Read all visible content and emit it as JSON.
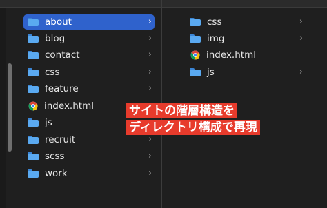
{
  "left_column": {
    "items": [
      {
        "label": "about",
        "icon": "folder-icon"
      },
      {
        "label": "blog",
        "icon": "folder-icon"
      },
      {
        "label": "contact",
        "icon": "folder-icon"
      },
      {
        "label": "css",
        "icon": "folder-icon"
      },
      {
        "label": "feature",
        "icon": "folder-icon"
      },
      {
        "label": "index.html",
        "icon": "chrome-html-icon"
      },
      {
        "label": "js",
        "icon": "folder-icon"
      },
      {
        "label": "recruit",
        "icon": "folder-icon"
      },
      {
        "label": "scss",
        "icon": "folder-icon"
      },
      {
        "label": "work",
        "icon": "folder-icon"
      }
    ],
    "selected": "about"
  },
  "right_column": {
    "items": [
      {
        "label": "css",
        "icon": "folder-icon"
      },
      {
        "label": "img",
        "icon": "folder-icon"
      },
      {
        "label": "index.html",
        "icon": "chrome-html-icon"
      },
      {
        "label": "js",
        "icon": "folder-icon"
      }
    ]
  },
  "chevron": "›",
  "overlay": {
    "line1": "サイトの階層構造を",
    "line2": "ディレクトリ構成で再現"
  },
  "colors": {
    "background": "#1f1f1f",
    "selection": "#2f62cc",
    "folder": "#5aa9f0",
    "overlay": "#e73b2c"
  }
}
